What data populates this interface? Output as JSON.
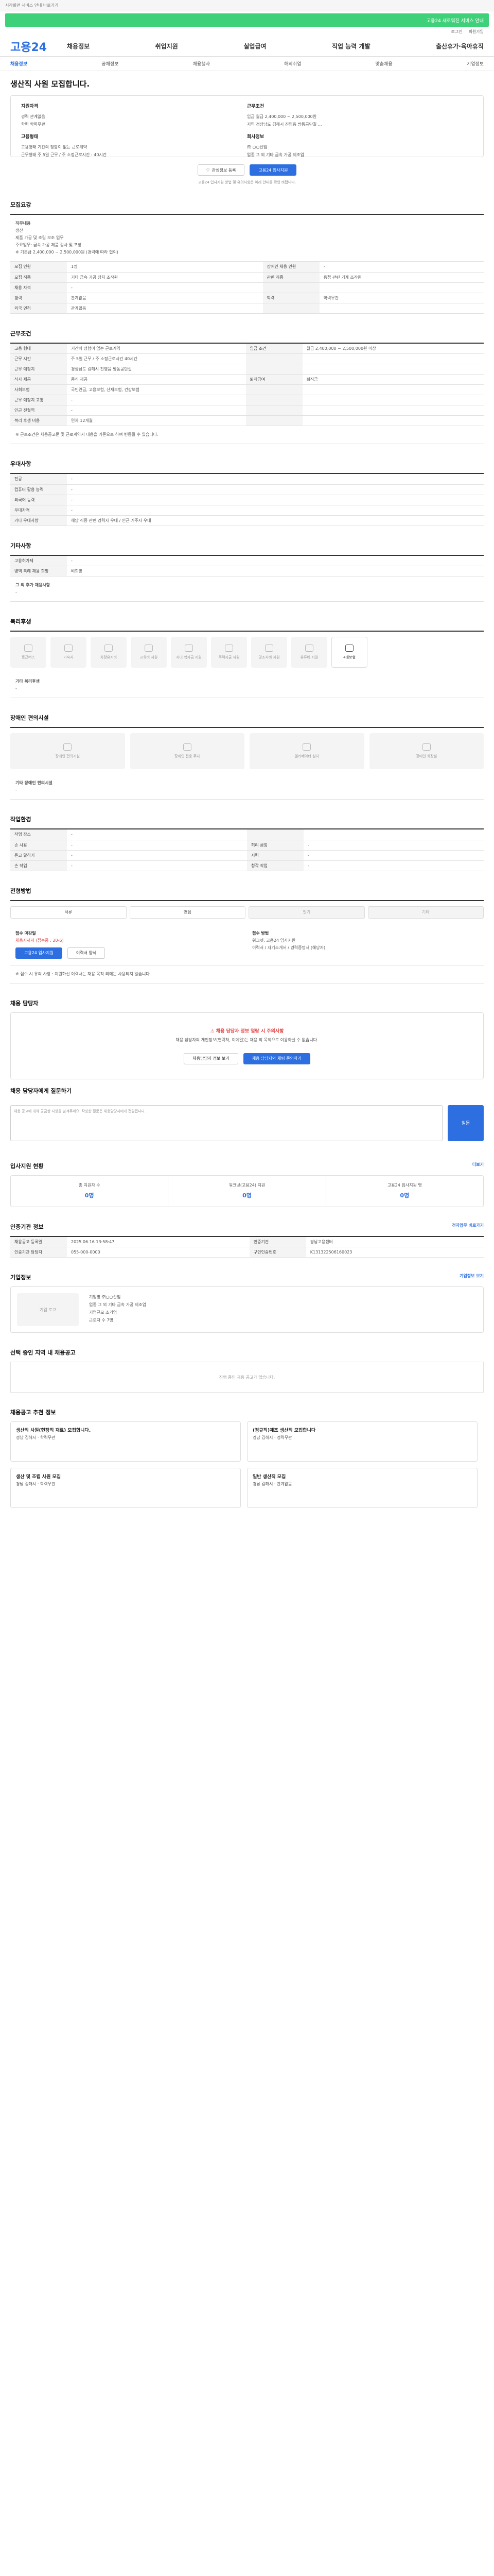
{
  "top": {
    "strip": "시작화면 서비스 안내 바로가기",
    "banner": "고용24 새로워진 서비스 안내"
  },
  "util": [
    "로그인",
    "회원가입"
  ],
  "logo": "고용24",
  "gnb": [
    "채용정보",
    "취업지원",
    "실업급여",
    "직업 능력 개발",
    "출산휴가·육아휴직"
  ],
  "subnav": [
    "채용정보",
    "공채정보",
    "채용행사",
    "해외취업",
    "맞춤채용",
    "기업정보"
  ],
  "job": {
    "title": "생산직 사원 모집합니다.",
    "summary_left_title": "지원자격",
    "summary_left": [
      "경력 관계없음",
      "학력 학력무관"
    ],
    "summary_left2_title": "고용형태",
    "summary_left2": [
      "고용형태 기간의 정함이 없는 근로계약",
      "근무형태 주 5일 근무 / 주 소정근로시간 : 40시간"
    ],
    "summary_right_title": "근무조건",
    "summary_right": [
      "임금 월급 2,400,000 ~ 2,500,000원",
      "지역 경상남도 김해시 진영읍 방동공단길 ..."
    ],
    "summary_right2_title": "회사정보",
    "summary_right2": [
      "㈜ ○○산업",
      "업종 그 외 기타 금속 가공 제조업"
    ],
    "btn_interest": "관심정보 등록",
    "btn_apply": "고용24 입사지원",
    "note": "고용24 입사지원 방법 및 유의사항은 아래 안내를 확인 바랍니다."
  },
  "recruit": {
    "title": "모집요강",
    "duty_title": "직무내용",
    "duty": [
      "생산",
      "제품 가공 및 조립 보조 업무",
      "주요업무: 금속 가공 제품 검사 및 포장",
      "※ 기본급 2,400,000 ~ 2,500,000원 (경력에 따라 협의)"
    ],
    "rows": [
      [
        "모집 인원",
        "1명",
        "장애인 채용 인원",
        "-"
      ],
      [
        "모집 직종",
        "기타 금속 가공 장치 조작원",
        "관련 직종",
        "용접 관련 기계 조작원"
      ],
      [
        "채용 자격",
        "-",
        "",
        ""
      ],
      [
        "경력",
        "관계없음",
        "학력",
        "학력무관"
      ],
      [
        "외국 면허",
        "관계없음",
        "",
        ""
      ]
    ]
  },
  "conditions": {
    "title": "근무조건",
    "rows": [
      [
        "고용 형태",
        "기간의 정함이 없는 근로계약",
        "임금 조건",
        "월급 2,400,000 ~ 2,500,000원 이상"
      ],
      [
        "근무 시간",
        "주 5일 근무 / 주 소정근로시간 40시간",
        "",
        ""
      ],
      [
        "근무 예정지",
        "경상남도 김해시 진영읍 방동공단길",
        "",
        ""
      ],
      [
        "식사 제공",
        "중식 제공",
        "퇴직급여",
        "퇴직금"
      ],
      [
        "사회보험",
        "국민연금, 고용보험, 산재보험, 건강보험",
        "",
        ""
      ],
      [
        "근무 예정지 교통",
        "-",
        "",
        ""
      ],
      [
        "인근 전철역",
        "-",
        "",
        ""
      ],
      [
        "복리 후생 비용",
        "연차 12개월",
        "",
        ""
      ]
    ],
    "note": "※ 근로조건은 채용공고문 및 근로계약서 내용을 기준으로 하며 변동될 수 있습니다."
  },
  "priority": {
    "title": "우대사항",
    "rows": [
      [
        "전공",
        "-"
      ],
      [
        "컴퓨터 활용 능력",
        "-"
      ],
      [
        "외국어 능력",
        "-"
      ],
      [
        "우대자격",
        "-"
      ],
      [
        "기타 우대사항",
        "해당 직종 관련 경력자 우대 / 인근 거주자 우대"
      ]
    ]
  },
  "etc": {
    "title": "기타사항",
    "rows": [
      [
        "고용허가제",
        "-"
      ],
      [
        "병역 특례 채용 희망",
        "비희망"
      ]
    ],
    "extra_label": "그 외 추가 채용사항",
    "extra_value": "-"
  },
  "welfare": {
    "title": "복리후생",
    "items": [
      "통근버스",
      "기숙사",
      "차량유지비",
      "교육비 지원",
      "자녀 학자금 지원",
      "주택자금 지원",
      "경조사비 지원",
      "유류비 지원",
      "4대보험"
    ],
    "on": [
      8
    ],
    "other_label": "기타 복리후생",
    "other_value": "-"
  },
  "disability": {
    "title": "장애인 편의시설",
    "items": [
      "장애인 편의시설",
      "장애인 전용 주차",
      "엘리베이터 설치",
      "장애인 화장실"
    ],
    "other_label": "기타 장애인 편의시설",
    "other_value": "-"
  },
  "env": {
    "title": "작업환경",
    "rows": [
      [
        "작업 장소",
        "-",
        "",
        ""
      ],
      [
        "손 사용",
        "-",
        "허리 굽힘",
        "-"
      ],
      [
        "듣고 말하기",
        "-",
        "시력",
        "-"
      ],
      [
        "손 작업",
        "-",
        "청각 작업",
        "-"
      ]
    ]
  },
  "process": {
    "title": "전형방법",
    "steps": [
      "서류",
      "면접",
      "필기",
      "기타"
    ],
    "off": [
      2,
      3
    ]
  },
  "receipt": {
    "deadline_label": "접수 마감일",
    "deadline": "채용시까지 (접수중 : 20-6)",
    "method_label": "접수 방법",
    "method": "워크넷, 고용24 입사지원",
    "docs": "이력서 / 자기소개서 / 경력증명서 (해당자)",
    "btn_apply": "고용24 입사지원",
    "btn_print": "이력서 양식",
    "notes": "※ 접수 시 유의 사항 : 지원하신 이력서는 채용 목적 외에는 사용되지 않습니다."
  },
  "contact": {
    "title": "채용 담당자",
    "warn": "채용 담당자 정보 열람 시 주의사항",
    "msg": "채용 담당자의 개인정보(연락처, 이메일)는 채용 외 목적으로 이용하실 수 없습니다.",
    "btn_view": "채용담당자 정보 보기",
    "btn_ask": "채용 담당자와 채팅 문의하기"
  },
  "qa": {
    "title": "채용 담당자에게 질문하기",
    "placeholder": "채용 공고에 대해 궁금한 사항을 남겨주세요. 작성한 질문은 채용담당자에게 전달됩니다.",
    "btn": "질문"
  },
  "applicants": {
    "title": "입사지원 현황",
    "items": [
      [
        "총 지원자 수",
        "0명"
      ],
      [
        "워크넷(고용24) 지원",
        "0명"
      ],
      [
        "고용24 입사지원 명",
        "0명"
      ]
    ],
    "link": "더보기"
  },
  "info": {
    "title": "인증기관 정보",
    "rows": [
      [
        "채용공고 등록일",
        "2025.06.16 13:58:47",
        "인증기관",
        "경남고용센터"
      ],
      [
        "인증기관 담당자",
        "055-000-0000",
        "구인인증번호",
        "K131322506160023"
      ]
    ],
    "link": "전자업무 바로가기"
  },
  "company": {
    "title": "기업정보",
    "logo": "기업 로고",
    "rows": [
      "기업명 ㈜○○산업",
      "업종 그 외 기타 금속 가공 제조업",
      "기업규모 소기업",
      "근로자 수 7명"
    ],
    "link": "기업정보 보기"
  },
  "related": {
    "title": "선택 중인 지역 내 채용공고",
    "empty": "진행 중인 채용 공고가 없습니다."
  },
  "recommend": {
    "title": "채용공고 추천 정보",
    "items": [
      [
        "생산직 사원(현장직 재료) 모집합니다.",
        "경남 김해시 · 학력무관"
      ],
      [
        "(정규직)제조 생산직 모집합니다",
        "경남 김해시 · 경력무관"
      ],
      [
        "생산 및 조립 사원 모집",
        "경남 김해시 · 학력무관"
      ],
      [
        "일반 생산직 모집",
        "경남 김해시 · 관계없음"
      ]
    ]
  }
}
